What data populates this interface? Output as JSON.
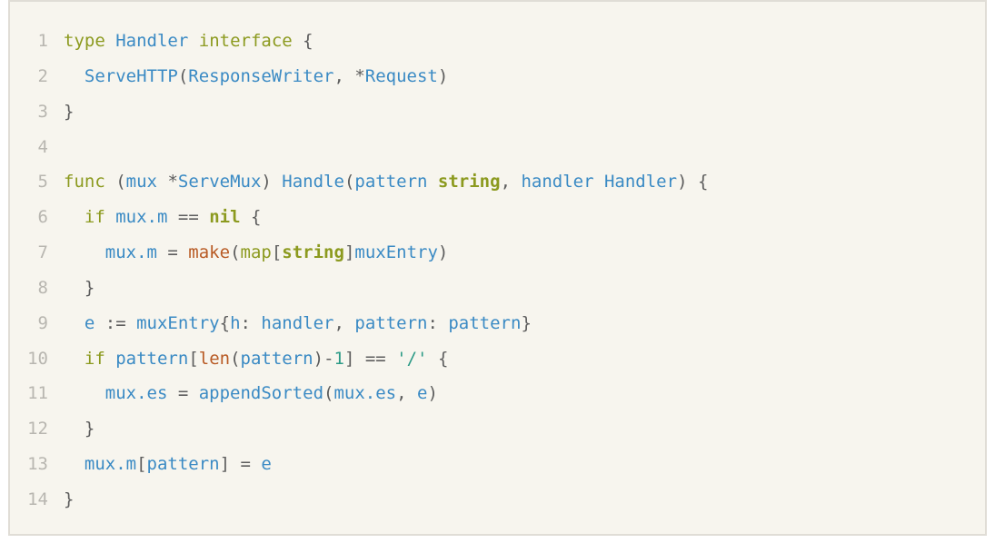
{
  "colors": {
    "background": "#f7f5ee",
    "border": "#e0ddd6",
    "line_number": "#b8b6b0",
    "keyword": "#8c9a1f",
    "identifier": "#3a8ac4",
    "builtin": "#b85a24",
    "number": "#2b9a86",
    "punctuation": "#5d5d5d"
  },
  "language": "go",
  "lines": [
    {
      "n": "1",
      "tokens": [
        {
          "t": "type",
          "k": "kw"
        },
        {
          "t": " ",
          "k": "p"
        },
        {
          "t": "Handler",
          "k": "type"
        },
        {
          "t": " ",
          "k": "p"
        },
        {
          "t": "interface",
          "k": "kw"
        },
        {
          "t": " {",
          "k": "p"
        }
      ]
    },
    {
      "n": "2",
      "tokens": [
        {
          "t": "  ",
          "k": "p"
        },
        {
          "t": "ServeHTTP",
          "k": "type"
        },
        {
          "t": "(",
          "k": "p"
        },
        {
          "t": "ResponseWriter",
          "k": "type"
        },
        {
          "t": ", ",
          "k": "p"
        },
        {
          "t": "*",
          "k": "p"
        },
        {
          "t": "Request",
          "k": "type"
        },
        {
          "t": ")",
          "k": "p"
        }
      ]
    },
    {
      "n": "3",
      "tokens": [
        {
          "t": "}",
          "k": "p"
        }
      ]
    },
    {
      "n": "4",
      "tokens": []
    },
    {
      "n": "5",
      "tokens": [
        {
          "t": "func",
          "k": "kw"
        },
        {
          "t": " (",
          "k": "p"
        },
        {
          "t": "mux",
          "k": "type"
        },
        {
          "t": " ",
          "k": "p"
        },
        {
          "t": "*",
          "k": "p"
        },
        {
          "t": "ServeMux",
          "k": "type"
        },
        {
          "t": ") ",
          "k": "p"
        },
        {
          "t": "Handle",
          "k": "type"
        },
        {
          "t": "(",
          "k": "p"
        },
        {
          "t": "pattern",
          "k": "type"
        },
        {
          "t": " ",
          "k": "p"
        },
        {
          "t": "string",
          "k": "kwb"
        },
        {
          "t": ", ",
          "k": "p"
        },
        {
          "t": "handler",
          "k": "type"
        },
        {
          "t": " ",
          "k": "p"
        },
        {
          "t": "Handler",
          "k": "type"
        },
        {
          "t": ") {",
          "k": "p"
        }
      ]
    },
    {
      "n": "6",
      "tokens": [
        {
          "t": "  ",
          "k": "p"
        },
        {
          "t": "if",
          "k": "kw"
        },
        {
          "t": " ",
          "k": "p"
        },
        {
          "t": "mux.m",
          "k": "type"
        },
        {
          "t": " == ",
          "k": "p"
        },
        {
          "t": "nil",
          "k": "kwb"
        },
        {
          "t": " {",
          "k": "p"
        }
      ]
    },
    {
      "n": "7",
      "tokens": [
        {
          "t": "    ",
          "k": "p"
        },
        {
          "t": "mux.m",
          "k": "type"
        },
        {
          "t": " = ",
          "k": "p"
        },
        {
          "t": "make",
          "k": "bi"
        },
        {
          "t": "(",
          "k": "p"
        },
        {
          "t": "map",
          "k": "kw"
        },
        {
          "t": "[",
          "k": "p"
        },
        {
          "t": "string",
          "k": "kwb"
        },
        {
          "t": "]",
          "k": "p"
        },
        {
          "t": "muxEntry",
          "k": "type"
        },
        {
          "t": ")",
          "k": "p"
        }
      ]
    },
    {
      "n": "8",
      "tokens": [
        {
          "t": "  }",
          "k": "p"
        }
      ]
    },
    {
      "n": "9",
      "tokens": [
        {
          "t": "  ",
          "k": "p"
        },
        {
          "t": "e",
          "k": "type"
        },
        {
          "t": " := ",
          "k": "p"
        },
        {
          "t": "muxEntry",
          "k": "type"
        },
        {
          "t": "{",
          "k": "p"
        },
        {
          "t": "h",
          "k": "type"
        },
        {
          "t": ": ",
          "k": "p"
        },
        {
          "t": "handler",
          "k": "type"
        },
        {
          "t": ", ",
          "k": "p"
        },
        {
          "t": "pattern",
          "k": "type"
        },
        {
          "t": ": ",
          "k": "p"
        },
        {
          "t": "pattern",
          "k": "type"
        },
        {
          "t": "}",
          "k": "p"
        }
      ]
    },
    {
      "n": "10",
      "tokens": [
        {
          "t": "  ",
          "k": "p"
        },
        {
          "t": "if",
          "k": "kw"
        },
        {
          "t": " ",
          "k": "p"
        },
        {
          "t": "pattern",
          "k": "type"
        },
        {
          "t": "[",
          "k": "p"
        },
        {
          "t": "len",
          "k": "bi"
        },
        {
          "t": "(",
          "k": "p"
        },
        {
          "t": "pattern",
          "k": "type"
        },
        {
          "t": ")-",
          "k": "p"
        },
        {
          "t": "1",
          "k": "num"
        },
        {
          "t": "] == ",
          "k": "p"
        },
        {
          "t": "'/'",
          "k": "str"
        },
        {
          "t": " {",
          "k": "p"
        }
      ]
    },
    {
      "n": "11",
      "tokens": [
        {
          "t": "    ",
          "k": "p"
        },
        {
          "t": "mux.es",
          "k": "type"
        },
        {
          "t": " = ",
          "k": "p"
        },
        {
          "t": "appendSorted",
          "k": "type"
        },
        {
          "t": "(",
          "k": "p"
        },
        {
          "t": "mux.es",
          "k": "type"
        },
        {
          "t": ", ",
          "k": "p"
        },
        {
          "t": "e",
          "k": "type"
        },
        {
          "t": ")",
          "k": "p"
        }
      ]
    },
    {
      "n": "12",
      "tokens": [
        {
          "t": "  }",
          "k": "p"
        }
      ]
    },
    {
      "n": "13",
      "tokens": [
        {
          "t": "  ",
          "k": "p"
        },
        {
          "t": "mux.m",
          "k": "type"
        },
        {
          "t": "[",
          "k": "p"
        },
        {
          "t": "pattern",
          "k": "type"
        },
        {
          "t": "] = ",
          "k": "p"
        },
        {
          "t": "e",
          "k": "type"
        }
      ]
    },
    {
      "n": "14",
      "tokens": [
        {
          "t": "}",
          "k": "p"
        }
      ]
    }
  ]
}
